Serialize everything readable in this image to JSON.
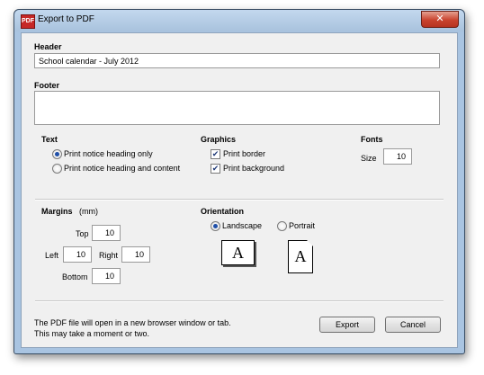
{
  "window": {
    "title": "Export to PDF",
    "icon_label": "PDF",
    "close_glyph": "✕"
  },
  "header": {
    "label": "Header",
    "value": "School calendar - July 2012"
  },
  "footer": {
    "label": "Footer",
    "value": ""
  },
  "text_group": {
    "label": "Text",
    "options": [
      {
        "label": "Print notice heading only",
        "selected": true
      },
      {
        "label": "Print notice heading and content",
        "selected": false
      }
    ]
  },
  "graphics_group": {
    "label": "Graphics",
    "options": [
      {
        "label": "Print border",
        "checked": true
      },
      {
        "label": "Print background",
        "checked": true
      }
    ]
  },
  "fonts_group": {
    "label": "Fonts",
    "size_label": "Size",
    "size_value": "10"
  },
  "margins": {
    "label": "Margins",
    "unit": "(mm)",
    "top_label": "Top",
    "top": "10",
    "left_label": "Left",
    "left": "10",
    "right_label": "Right",
    "right": "10",
    "bottom_label": "Bottom",
    "bottom": "10"
  },
  "orientation": {
    "label": "Orientation",
    "landscape_label": "Landscape",
    "landscape_selected": true,
    "portrait_label": "Portrait",
    "portrait_selected": false,
    "icon_glyph": "A"
  },
  "footer_note": {
    "line1": "The PDF file will open in a new browser window or tab.",
    "line2": "This may take a moment or two."
  },
  "buttons": {
    "export": "Export",
    "cancel": "Cancel"
  }
}
